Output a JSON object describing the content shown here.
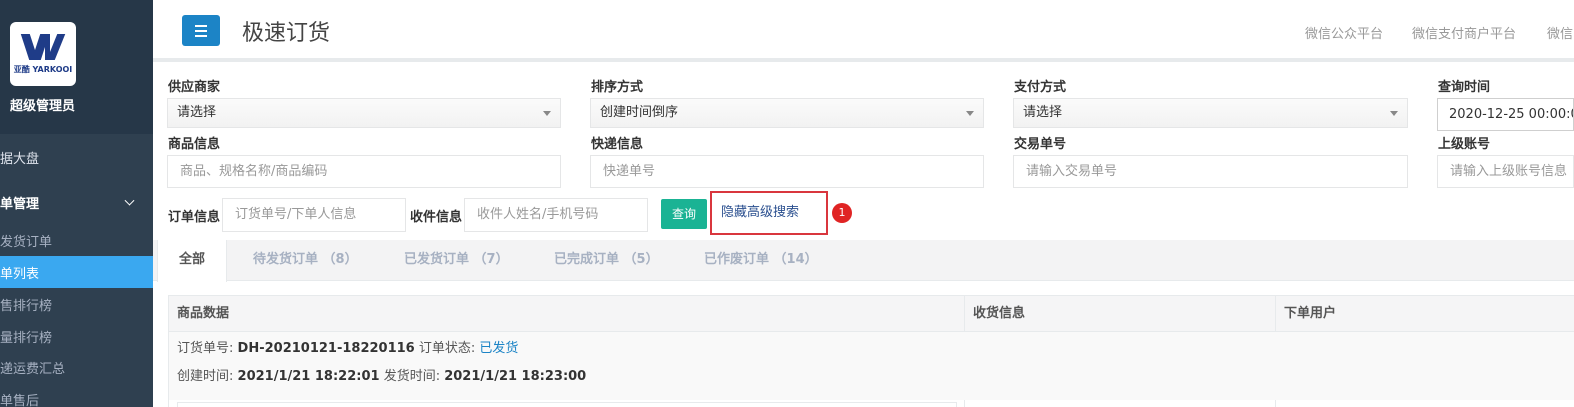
{
  "sidebar": {
    "logo_text": "亚酷 YARKOOI",
    "user_name": "超级管理员",
    "items": [
      {
        "label": "据大盘"
      },
      {
        "label": "单管理"
      },
      {
        "label": "发货订单"
      },
      {
        "label": "单列表"
      },
      {
        "label": "售排行榜"
      },
      {
        "label": "量排行榜"
      },
      {
        "label": "递运费汇总"
      },
      {
        "label": "单售后"
      }
    ]
  },
  "header": {
    "title": "极速订货",
    "links": [
      "微信公众平台",
      "微信支付商户平台",
      "微信"
    ]
  },
  "filters": {
    "supplier_label": "供应商家",
    "supplier_value": "请选择",
    "sort_label": "排序方式",
    "sort_value": "创建时间倒序",
    "pay_label": "支付方式",
    "pay_value": "请选择",
    "time_label": "查询时间",
    "time_value": "2020-12-25 00:00:0",
    "goods_label": "商品信息",
    "goods_placeholder": "商品、规格名称/商品编码",
    "express_label": "快递信息",
    "express_placeholder": "快递单号",
    "trade_label": "交易单号",
    "trade_placeholder": "请输入交易单号",
    "parent_label": "上级账号",
    "parent_placeholder": "请输入上级账号信息",
    "order_label": "订单信息",
    "order_placeholder": "订货单号/下单人信息",
    "receiver_label": "收件信息",
    "receiver_placeholder": "收件人姓名/手机号码",
    "query_button": "查询",
    "toggle_advanced": "隐藏高级搜索",
    "step_number": "1"
  },
  "tabs": [
    {
      "label": "全部",
      "active": true
    },
    {
      "label": "待发货订单 （8）",
      "active": false
    },
    {
      "label": "已发货订单 （7）",
      "active": false
    },
    {
      "label": "已完成订单 （5）",
      "active": false
    },
    {
      "label": "已作废订单 （14）",
      "active": false
    }
  ],
  "table": {
    "columns": [
      "商品数据",
      "收货信息",
      "下单用户"
    ],
    "order": {
      "no_label": "订货单号:",
      "no_value": "DH-20210121-18220116",
      "status_label": "订单状态:",
      "status_value": "已发货",
      "created_label": "创建时间:",
      "created_value": "2021/1/21 18:22:01",
      "shipped_label": "发货时间:",
      "shipped_value": "2021/1/21 18:23:00"
    }
  },
  "colors": {
    "sidebar_bg": "#2f4050",
    "active_nav": "#3aa8f0",
    "primary_button": "#1c84c6",
    "query_button": "#1ab394",
    "highlight_border": "#d9363e"
  }
}
